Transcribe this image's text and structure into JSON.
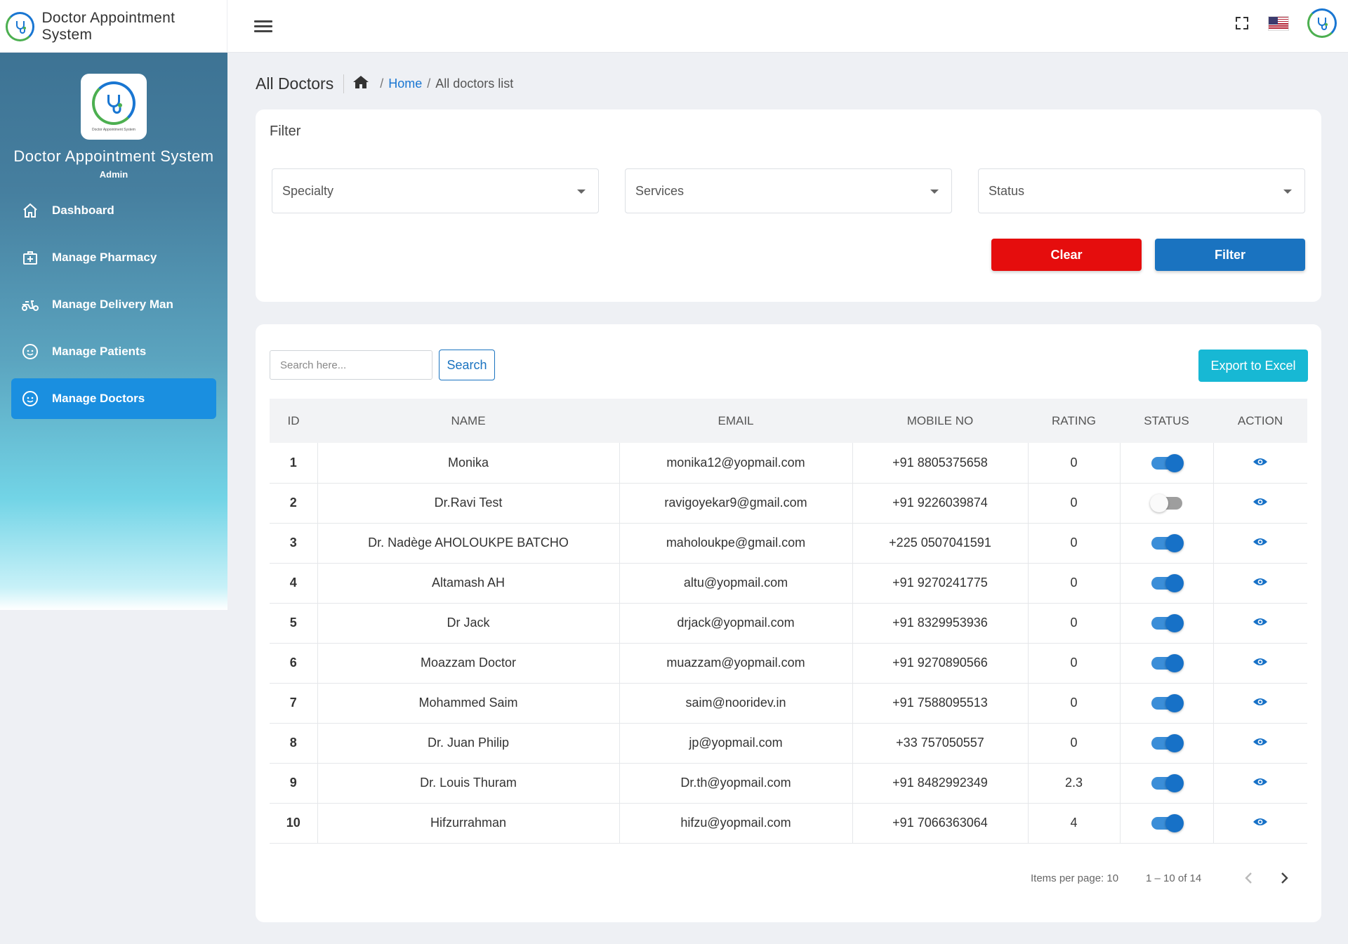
{
  "app": {
    "title": "Doctor Appointment System",
    "role": "Admin",
    "logo_caption": "Doctor Appointment System"
  },
  "icons": {
    "menu": "hamburger-icon",
    "fullscreen": "fullscreen-icon",
    "language": "us-flag-icon",
    "profile": "avatar-logo"
  },
  "sidebar": {
    "items": [
      {
        "label": "Dashboard",
        "icon": "home-icon",
        "active": false
      },
      {
        "label": "Manage Pharmacy",
        "icon": "medical-kit-icon",
        "active": false
      },
      {
        "label": "Manage Delivery Man",
        "icon": "scooter-icon",
        "active": false
      },
      {
        "label": "Manage Patients",
        "icon": "face-icon",
        "active": false
      },
      {
        "label": "Manage Doctors",
        "icon": "face-icon",
        "active": true
      }
    ]
  },
  "breadcrumb": {
    "title": "All Doctors",
    "home": "Home",
    "current": "All doctors list"
  },
  "filter": {
    "title": "Filter",
    "specialty": "Specialty",
    "services": "Services",
    "status": "Status",
    "clear_label": "Clear",
    "filter_label": "Filter"
  },
  "toolbar": {
    "search_placeholder": "Search here...",
    "search_label": "Search",
    "export_label": "Export to Excel"
  },
  "table": {
    "headers": [
      "ID",
      "NAME",
      "EMAIL",
      "MOBILE NO",
      "RATING",
      "STATUS",
      "ACTION"
    ],
    "rows": [
      {
        "id": "1",
        "name": "Monika",
        "email": "monika12@yopmail.com",
        "mobile": "+91 8805375658",
        "rating": "0",
        "status": true
      },
      {
        "id": "2",
        "name": "Dr.Ravi Test",
        "email": "ravigoyekar9@gmail.com",
        "mobile": "+91 9226039874",
        "rating": "0",
        "status": false
      },
      {
        "id": "3",
        "name": "Dr. Nadège AHOLOUKPE BATCHO",
        "email": "maholoukpe@gmail.com",
        "mobile": "+225 0507041591",
        "rating": "0",
        "status": true
      },
      {
        "id": "4",
        "name": "Altamash AH",
        "email": "altu@yopmail.com",
        "mobile": "+91 9270241775",
        "rating": "0",
        "status": true
      },
      {
        "id": "5",
        "name": "Dr Jack",
        "email": "drjack@yopmail.com",
        "mobile": "+91 8329953936",
        "rating": "0",
        "status": true
      },
      {
        "id": "6",
        "name": "Moazzam Doctor",
        "email": "muazzam@yopmail.com",
        "mobile": "+91 9270890566",
        "rating": "0",
        "status": true
      },
      {
        "id": "7",
        "name": "Mohammed Saim",
        "email": "saim@nooridev.in",
        "mobile": "+91 7588095513",
        "rating": "0",
        "status": true
      },
      {
        "id": "8",
        "name": "Dr. Juan Philip",
        "email": "jp@yopmail.com",
        "mobile": "+33 757050557",
        "rating": "0",
        "status": true
      },
      {
        "id": "9",
        "name": "Dr. Louis Thuram",
        "email": "Dr.th@yopmail.com",
        "mobile": "+91 8482992349",
        "rating": "2.3",
        "status": true
      },
      {
        "id": "10",
        "name": "Hifzurrahman",
        "email": "hifzu@yopmail.com",
        "mobile": "+91 7066363064",
        "rating": "4",
        "status": true
      }
    ]
  },
  "pagination": {
    "items_per_page": "Items per page: 10",
    "range": "1 – 10 of 14"
  },
  "colors": {
    "sidebar_top": "#3d7394",
    "active_nav": "#1a8fe0",
    "clear_button": "#e50d0d",
    "filter_button": "#1a73c0",
    "export_button": "#17b8d4",
    "toggle_on": "#1771c7"
  }
}
